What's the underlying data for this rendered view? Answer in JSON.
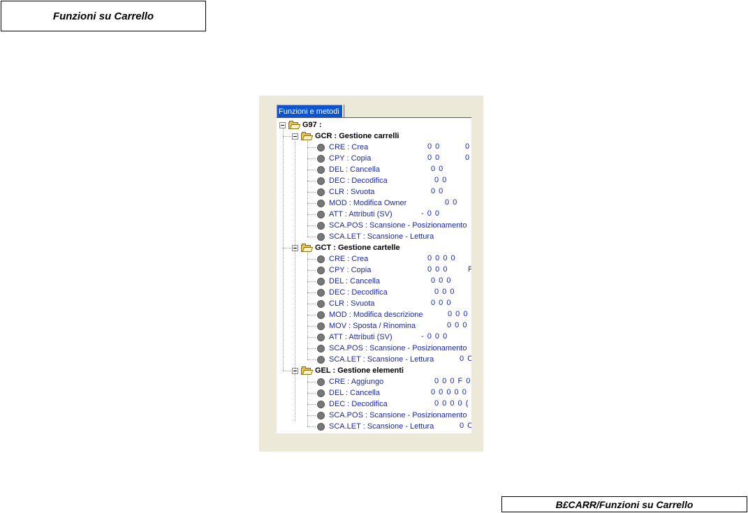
{
  "header": {
    "title": "Funzioni su Carrello"
  },
  "footer": {
    "label": "B£CARR/Funzioni su Carrello"
  },
  "panel": {
    "tab_label": "Funzioni e metodi"
  },
  "tree": {
    "root": "G97  :",
    "groups": [
      {
        "label": "GCR  : Gestione carrelli",
        "items": [
          {
            "label": "CRE  : Crea",
            "value": "0 0",
            "extra": "0"
          },
          {
            "label": "CPY  : Copia",
            "value": "0 0",
            "extra": "0"
          },
          {
            "label": "DEL  : Cancella",
            "value": "0 0"
          },
          {
            "label": "DEC  : Decodifica",
            "value": "0 0"
          },
          {
            "label": "CLR  : Svuota",
            "value": "0 0"
          },
          {
            "label": "MOD  : Modifica Owner",
            "value": "0 0"
          },
          {
            "label": "ATT  : Attributi (SV)",
            "value": "-  0 0"
          },
          {
            "label": "SCA.POS  : Scansione - Posizionamento",
            "value": ""
          },
          {
            "label": "SCA.LET  : Scansione - Lettura",
            "value": ""
          }
        ]
      },
      {
        "label": "GCT  : Gestione cartelle",
        "items": [
          {
            "label": "CRE  : Crea",
            "value": "0 0 0 0"
          },
          {
            "label": "CPY  : Copia",
            "value": "0 0 0",
            "extra": "F"
          },
          {
            "label": "DEL  : Cancella",
            "value": "0 0 0"
          },
          {
            "label": "DEC  : Decodifica",
            "value": "0 0 0"
          },
          {
            "label": "CLR  : Svuota",
            "value": "0 0 0"
          },
          {
            "label": "MOD  : Modifica descrizione",
            "value": "0 0 0"
          },
          {
            "label": "MOV  : Sposta / Rinomina",
            "value": "0 0 0"
          },
          {
            "label": "ATT  : Attributi (SV)",
            "value": "-  0 0 0"
          },
          {
            "label": "SCA.POS  : Scansione - Posizionamento",
            "value": ""
          },
          {
            "label": "SCA.LET  : Scansione - Lettura",
            "value": "0 C"
          }
        ]
      },
      {
        "label": "GEL  : Gestione elementi",
        "items": [
          {
            "label": "CRE  : Aggiungo",
            "value": "0 0 0 F 0"
          },
          {
            "label": "DEL  : Cancella",
            "value": "0 0 0  0 0"
          },
          {
            "label": "DEC  : Decodifica",
            "value": "0 0 0  0 ("
          },
          {
            "label": "SCA.POS  : Scansione - Posizionamento",
            "value": ""
          },
          {
            "label": "SCA.LET  : Scansione - Lettura",
            "value": "0 C"
          }
        ]
      }
    ]
  }
}
